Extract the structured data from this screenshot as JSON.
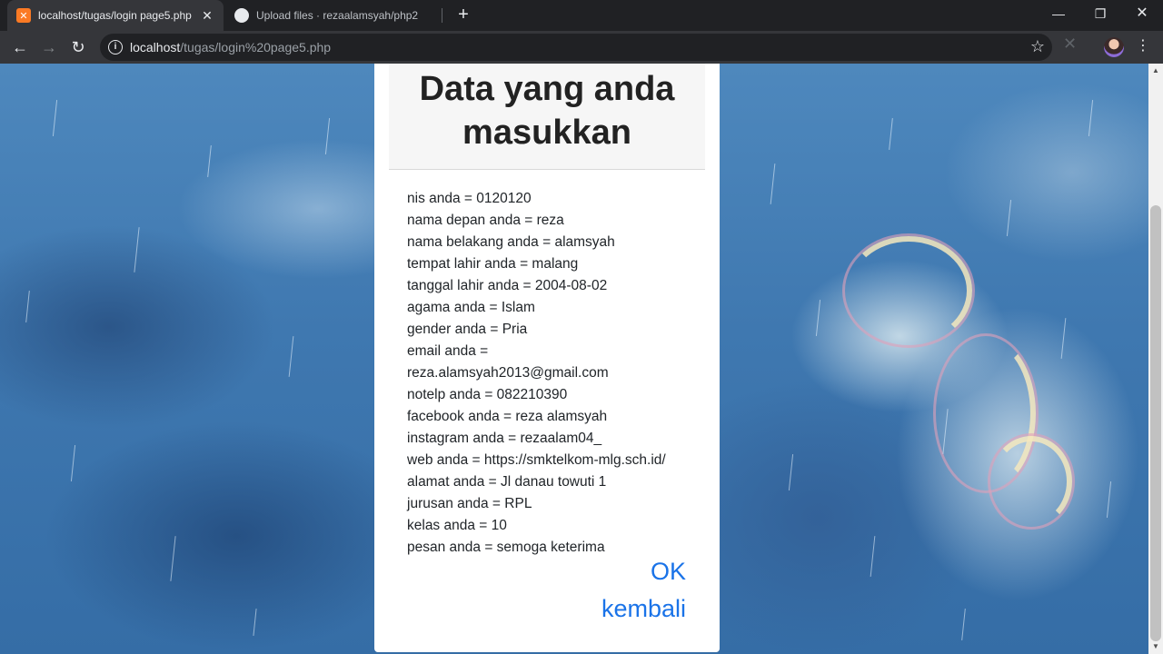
{
  "browser": {
    "tabs": [
      {
        "title": "localhost/tugas/login page5.php",
        "active": true,
        "favicon": "xampp-icon"
      },
      {
        "title": "Upload files · rezaalamsyah/php2",
        "active": false,
        "favicon": "github-icon"
      }
    ],
    "url_host": "localhost",
    "url_path": "/tugas/login%20page5.php"
  },
  "page": {
    "title": "Data yang anda masukkan",
    "fields": [
      "nis anda = 0120120",
      "nama depan anda = reza",
      "nama belakang anda = alamsyah",
      "tempat lahir anda = malang",
      "tanggal lahir anda = 2004-08-02",
      "agama anda = Islam",
      "gender anda = Pria",
      "email anda = reza.alamsyah2013@gmail.com",
      "notelp anda = 082210390",
      "facebook anda = reza alamsyah",
      "instagram anda = rezaalam04_",
      "web anda = https://smktelkom-mlg.sch.id/",
      "alamat anda = Jl danau towuti 1",
      "jurusan anda = RPL",
      "kelas anda = 10",
      "pesan anda = semoga keterima"
    ],
    "ok_label": "OK",
    "back_label": "kembali"
  },
  "colors": {
    "link": "#1a73e8",
    "chrome_dark": "#202124",
    "chrome_toolbar": "#35363a"
  }
}
